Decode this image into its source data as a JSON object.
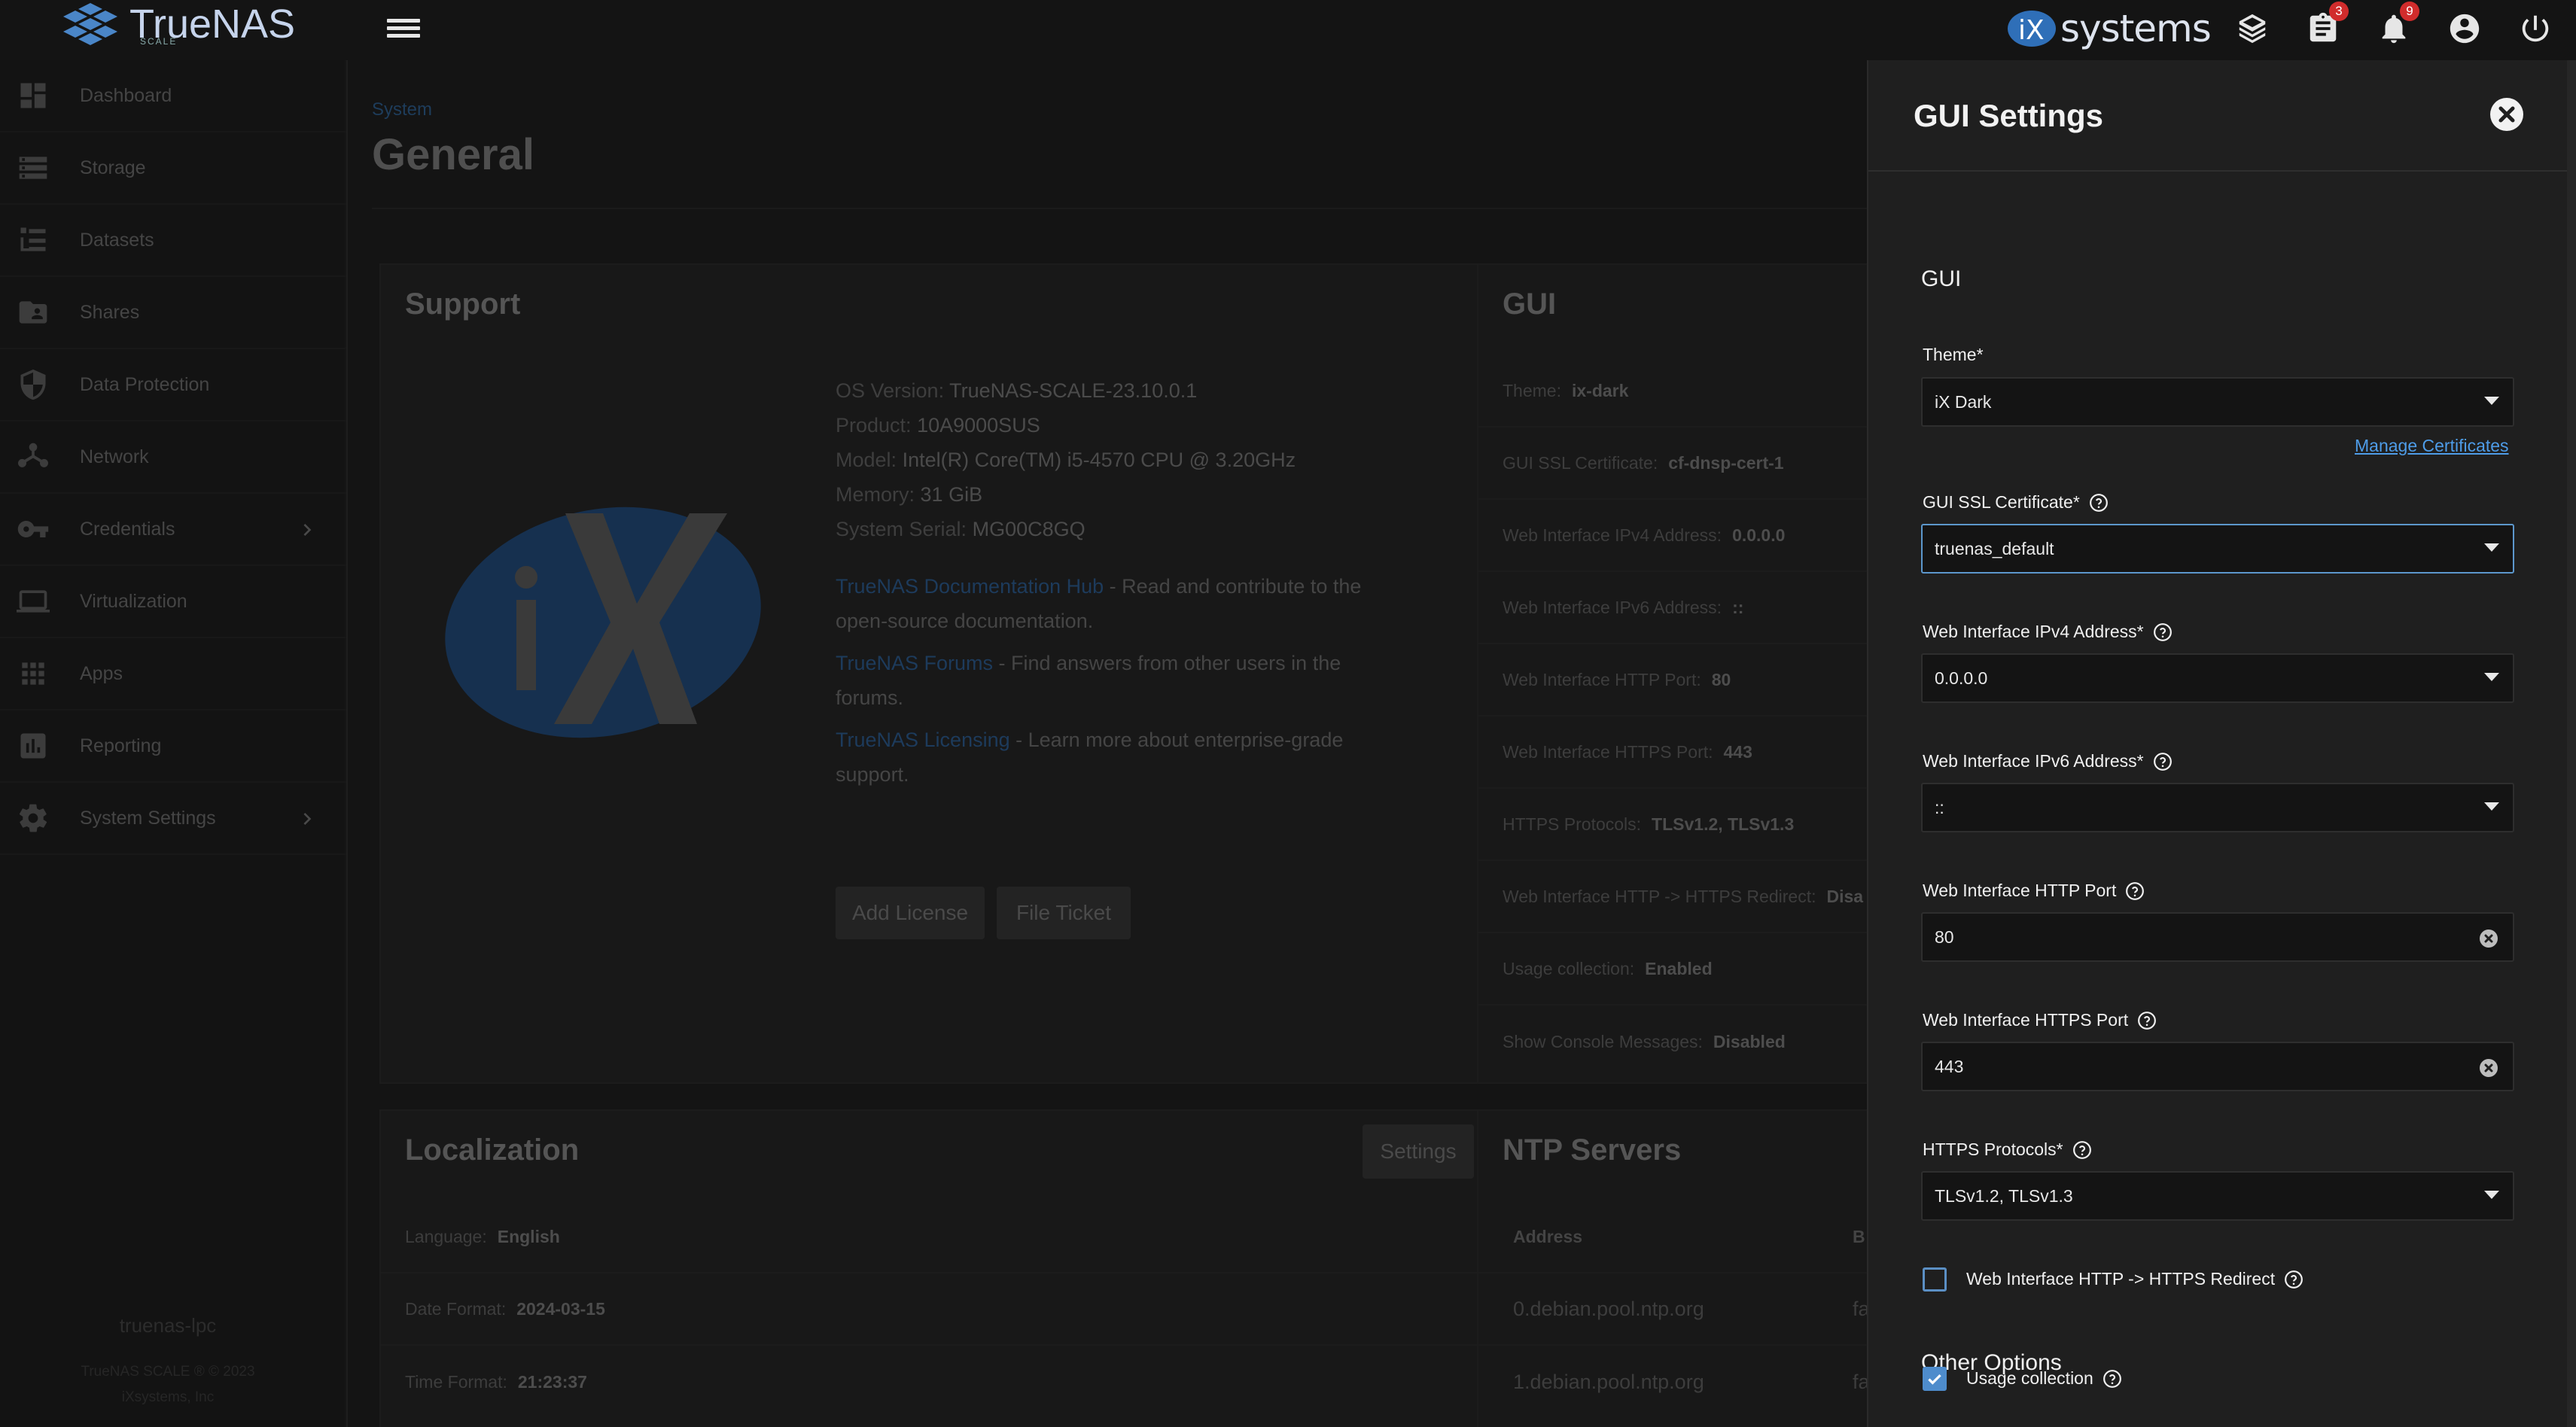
{
  "app": {
    "name": "TrueNAS",
    "edition": "SCALE",
    "vendor": "systems"
  },
  "topbar": {
    "tasks_badge": "3",
    "alerts_badge": "9"
  },
  "sidebar": {
    "items": [
      {
        "label": "Dashboard",
        "icon": "dashboard-icon"
      },
      {
        "label": "Storage",
        "icon": "storage-icon"
      },
      {
        "label": "Datasets",
        "icon": "datasets-icon"
      },
      {
        "label": "Shares",
        "icon": "shares-icon"
      },
      {
        "label": "Data Protection",
        "icon": "shield-icon"
      },
      {
        "label": "Network",
        "icon": "network-icon"
      },
      {
        "label": "Credentials",
        "icon": "key-icon"
      },
      {
        "label": "Virtualization",
        "icon": "laptop-icon"
      },
      {
        "label": "Apps",
        "icon": "apps-grid-icon"
      },
      {
        "label": "Reporting",
        "icon": "reporting-icon"
      },
      {
        "label": "System Settings",
        "icon": "gear-icon"
      }
    ],
    "hostname": "truenas-lpc",
    "copyright": "TrueNAS SCALE ® © 2023",
    "company": "iXsystems, Inc"
  },
  "page": {
    "breadcrumb": "System",
    "title": "General"
  },
  "support": {
    "title": "Support",
    "os_version_label": "OS Version:",
    "os_version": "TrueNAS-SCALE-23.10.0.1",
    "product_label": "Product:",
    "product": "10A9000SUS",
    "model_label": "Model:",
    "model": "Intel(R) Core(TM) i5-4570 CPU @ 3.20GHz",
    "memory_label": "Memory:",
    "memory": "31 GiB",
    "serial_label": "System Serial:",
    "serial": "MG00C8GQ",
    "docs_link": "TrueNAS Documentation Hub",
    "docs_desc": " - Read and contribute to the open-source documentation.",
    "forums_link": "TrueNAS Forums",
    "forums_desc": " - Find answers from other users in the forums.",
    "licensing_link": "TrueNAS Licensing",
    "licensing_desc": " - Learn more about enterprise-grade support.",
    "add_license": "Add License",
    "file_ticket": "File Ticket"
  },
  "gui_card": {
    "title": "GUI",
    "rows": [
      {
        "k": "Theme:",
        "v": "ix-dark"
      },
      {
        "k": "GUI SSL Certificate:",
        "v": "cf-dnsp-cert-1"
      },
      {
        "k": "Web Interface IPv4 Address:",
        "v": "0.0.0.0"
      },
      {
        "k": "Web Interface IPv6 Address:",
        "v": "::"
      },
      {
        "k": "Web Interface HTTP Port:",
        "v": "80"
      },
      {
        "k": "Web Interface HTTPS Port:",
        "v": "443"
      },
      {
        "k": "HTTPS Protocols:",
        "v": "TLSv1.2, TLSv1.3"
      },
      {
        "k": "Web Interface HTTP -> HTTPS Redirect:",
        "v": "Disa"
      },
      {
        "k": "Usage collection:",
        "v": "Enabled"
      },
      {
        "k": "Show Console Messages:",
        "v": "Disabled"
      }
    ]
  },
  "localization": {
    "title": "Localization",
    "settings_button": "Settings",
    "language_label": "Language:",
    "language": "English",
    "date_format_label": "Date Format:",
    "date_format": "2024-03-15",
    "time_format_label": "Time Format:",
    "time_format": "21:23:37"
  },
  "ntp": {
    "title": "NTP Servers",
    "col_address": "Address",
    "col_b": "B",
    "rows": [
      {
        "address": "0.debian.pool.ntp.org",
        "b": "fa"
      },
      {
        "address": "1.debian.pool.ntp.org",
        "b": "fa"
      }
    ]
  },
  "panel": {
    "title": "GUI Settings",
    "section_gui": "GUI",
    "theme_label": "Theme",
    "theme_value": "iX Dark",
    "cert_label": "GUI SSL Certificate",
    "cert_value": "truenas_default",
    "manage_certs": "Manage Certificates",
    "ipv4_label": "Web Interface IPv4 Address",
    "ipv4_value": "0.0.0.0",
    "ipv6_label": "Web Interface IPv6 Address",
    "ipv6_value": "::",
    "http_port_label": "Web Interface HTTP Port",
    "http_port_value": "80",
    "https_port_label": "Web Interface HTTPS Port",
    "https_port_value": "443",
    "protocols_label": "HTTPS Protocols",
    "protocols_value": "TLSv1.2, TLSv1.3",
    "redirect_label": "Web Interface HTTP -> HTTPS Redirect",
    "redirect_checked": false,
    "section_other": "Other Options",
    "usage_label": "Usage collection",
    "usage_checked": true,
    "required_mark": "*"
  },
  "colors": {
    "accent": "#4e8ccc",
    "link": "#4e9ce8",
    "badge": "#d12c2c",
    "panel_bg": "#1f1f1f"
  }
}
